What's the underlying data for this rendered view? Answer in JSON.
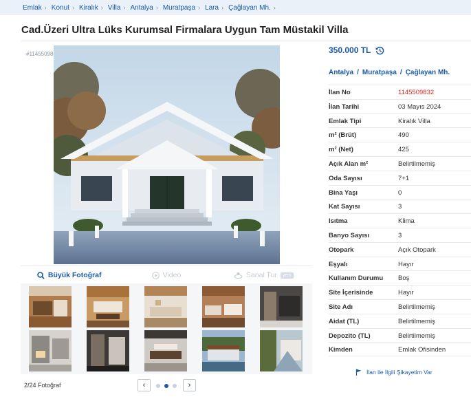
{
  "breadcrumb": [
    "Emlak",
    "Konut",
    "Kiralık",
    "Villa",
    "Antalya",
    "Muratpaşa",
    "Lara",
    "Çağlayan Mh."
  ],
  "title": "Cad.Üzeri Ultra Lüks Kurumsal Firmalara Uygun Tam Müstakil Villa",
  "gallery": {
    "listing_id_faint": "#1145509832",
    "tabs": {
      "big_photo": "Büyük Fotoğraf",
      "video": "Video",
      "virtual_tour": "Sanal Tur",
      "new_badge": "yeni"
    },
    "photo_count": "2/24 Fotoğraf",
    "pager": {
      "prev": "‹",
      "next": "›",
      "dots": 3,
      "active_dot": 1
    }
  },
  "price": "350.000 TL",
  "location": [
    "Antalya",
    "Muratpaşa",
    "Çağlayan Mh."
  ],
  "location_sep": "/",
  "details": [
    {
      "label": "İlan No",
      "value": "1145509832",
      "highlight": true
    },
    {
      "label": "İlan Tarihi",
      "value": "03 Mayıs 2024"
    },
    {
      "label": "Emlak Tipi",
      "value": "Kiralık Villa"
    },
    {
      "label": "m² (Brüt)",
      "value": "490"
    },
    {
      "label": "m² (Net)",
      "value": "425"
    },
    {
      "label": "Açık Alan m²",
      "value": "Belirtilmemiş"
    },
    {
      "label": "Oda Sayısı",
      "value": "7+1"
    },
    {
      "label": "Bina Yaşı",
      "value": "0"
    },
    {
      "label": "Kat Sayısı",
      "value": "3"
    },
    {
      "label": "Isıtma",
      "value": "Klima"
    },
    {
      "label": "Banyo Sayısı",
      "value": "3"
    },
    {
      "label": "Otopark",
      "value": "Açık Otopark"
    },
    {
      "label": "Eşyalı",
      "value": "Hayır"
    },
    {
      "label": "Kullanım Durumu",
      "value": "Boş"
    },
    {
      "label": "Site İçerisinde",
      "value": "Hayır"
    },
    {
      "label": "Site Adı",
      "value": "Belirtilmemiş"
    },
    {
      "label": "Aidat (TL)",
      "value": "Belirtilmemiş"
    },
    {
      "label": "Depozito (TL)",
      "value": "Belirtilmemiş"
    },
    {
      "label": "Kimden",
      "value": "Emlak Ofisinden"
    }
  ],
  "report_link": "İlan ile İlgili Şikayetim Var",
  "colors": {
    "link": "#1b5aa6",
    "highlight": "#e2281f"
  }
}
